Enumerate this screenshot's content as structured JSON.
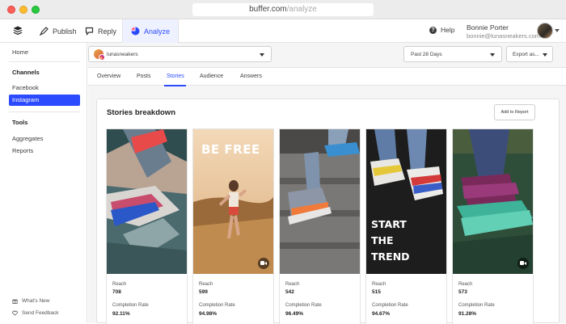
{
  "browser": {
    "url_host": "buffer.com",
    "url_path": "/analyze"
  },
  "nav": {
    "tabs": [
      {
        "label": "Publish",
        "icon": "publish-icon"
      },
      {
        "label": "Reply",
        "icon": "reply-icon"
      },
      {
        "label": "Analyze",
        "icon": "analyze-icon"
      }
    ],
    "help_label": "Help",
    "user": {
      "name": "Bonnie Porter",
      "email": "bonnie@lunasneakers.com"
    }
  },
  "sidebar": {
    "home": "Home",
    "channels_heading": "Channels",
    "channels": [
      "Facebook",
      "Instagram"
    ],
    "active_channel": "Instagram",
    "tools_heading": "Tools",
    "tools": [
      "Aggregates",
      "Reports"
    ],
    "footer": [
      {
        "label": "What's New",
        "icon": "gift-icon"
      },
      {
        "label": "Send Feedback",
        "icon": "heart-icon"
      }
    ]
  },
  "toolbar": {
    "account": "lunasneakers",
    "date_range": "Past 28 Days",
    "export_label": "Export as..."
  },
  "tabs": [
    "Overview",
    "Posts",
    "Stories",
    "Audience",
    "Answers"
  ],
  "active_tab": "Stories",
  "stories": {
    "title": "Stories breakdown",
    "add_to_report": "Add to Report",
    "reach_label": "Reach",
    "completion_label": "Completion Rate",
    "items": [
      {
        "reach": "708",
        "completion": "92.11%",
        "overlay": "",
        "video": false
      },
      {
        "reach": "599",
        "completion": "94.98%",
        "overlay": "BE FREE",
        "video": true
      },
      {
        "reach": "542",
        "completion": "96.49%",
        "overlay": "",
        "video": false
      },
      {
        "reach": "515",
        "completion": "94.67%",
        "overlay": "START THE TREND",
        "video": false
      },
      {
        "reach": "573",
        "completion": "91.28%",
        "overlay": "",
        "video": true
      }
    ]
  },
  "colors": {
    "accent": "#2c4bff",
    "active_tab_bg": "#eef1ff"
  }
}
